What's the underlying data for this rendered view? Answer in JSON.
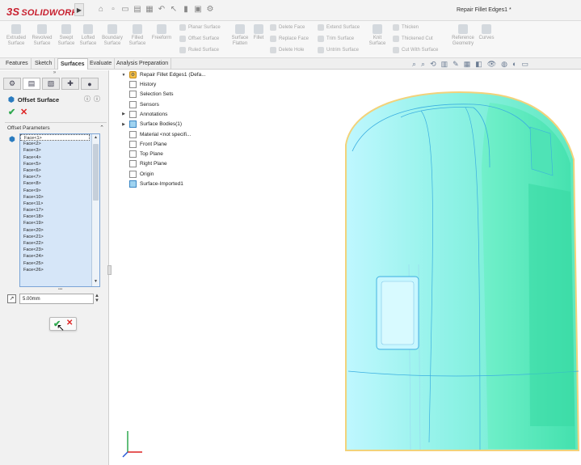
{
  "app": {
    "brand": "SOLIDWORKS",
    "document_title": "Repair Fillet Edges1 *"
  },
  "ribbon": {
    "large_buttons": [
      {
        "label": "Extruded\nSurface",
        "icon": "extruded-surface-icon"
      },
      {
        "label": "Revolved\nSurface",
        "icon": "revolved-surface-icon"
      },
      {
        "label": "Swept\nSurface",
        "icon": "swept-surface-icon"
      },
      {
        "label": "Lofted\nSurface",
        "icon": "lofted-surface-icon"
      },
      {
        "label": "Boundary\nSurface",
        "icon": "boundary-surface-icon"
      },
      {
        "label": "Filled\nSurface",
        "icon": "filled-surface-icon"
      },
      {
        "label": "Freeform",
        "icon": "freeform-icon"
      }
    ],
    "col1": [
      "Planar Surface",
      "Offset Surface",
      "Ruled Surface"
    ],
    "surface_flatten": "Surface\nFlatten",
    "fillet": "Fillet",
    "col2": [
      "Delete Face",
      "Replace Face",
      "Delete Hole"
    ],
    "col3": [
      "Extend Surface",
      "Trim Surface",
      "Untrim Surface"
    ],
    "knit_surface": "Knit\nSurface",
    "col4": [
      "Thicken",
      "Thickened Cut",
      "Cut With Surface"
    ],
    "reference_geometry": "Reference\nGeometry",
    "curves": "Curves"
  },
  "tabs": [
    "Features",
    "Sketch",
    "Surfaces",
    "Evaluate",
    "Analysis Preparation"
  ],
  "active_tab": "Surfaces",
  "property_manager": {
    "title": "Offset Surface",
    "group_label": "Offset Parameters",
    "faces": [
      "Face<1>",
      "Face<2>",
      "Face<3>",
      "Face<4>",
      "Face<5>",
      "Face<6>",
      "Face<7>",
      "Face<8>",
      "Face<9>",
      "Face<10>",
      "Face<11>",
      "Face<17>",
      "Face<18>",
      "Face<19>",
      "Face<20>",
      "Face<21>",
      "Face<22>",
      "Face<23>",
      "Face<24>",
      "Face<25>",
      "Face<26>"
    ],
    "offset_distance": "5.00mm"
  },
  "tree": {
    "root": "Repair Fillet Edges1  (Defa...",
    "items": [
      {
        "label": "History",
        "icon": "history-icon",
        "expandable": false
      },
      {
        "label": "Selection Sets",
        "icon": "selection-sets-icon",
        "expandable": false
      },
      {
        "label": "Sensors",
        "icon": "sensors-icon",
        "expandable": false
      },
      {
        "label": "Annotations",
        "icon": "annotations-icon",
        "expandable": true
      },
      {
        "label": "Surface Bodies(1)",
        "icon": "surface-bodies-icon",
        "expandable": true
      },
      {
        "label": "Material <not specifi...",
        "icon": "material-icon",
        "expandable": false
      },
      {
        "label": "Front Plane",
        "icon": "plane-icon",
        "expandable": false
      },
      {
        "label": "Top Plane",
        "icon": "plane-icon",
        "expandable": false
      },
      {
        "label": "Right Plane",
        "icon": "plane-icon",
        "expandable": false
      },
      {
        "label": "Origin",
        "icon": "origin-icon",
        "expandable": false
      },
      {
        "label": "Surface-Imported1",
        "icon": "surface-imported-icon",
        "expandable": false
      }
    ]
  },
  "colors": {
    "brand_red": "#c8202f",
    "model_fill": "#7ff0d6",
    "model_edge": "#3aaee0",
    "selection_blue": "#d6e6f8",
    "ok_green": "#2fa84f"
  }
}
